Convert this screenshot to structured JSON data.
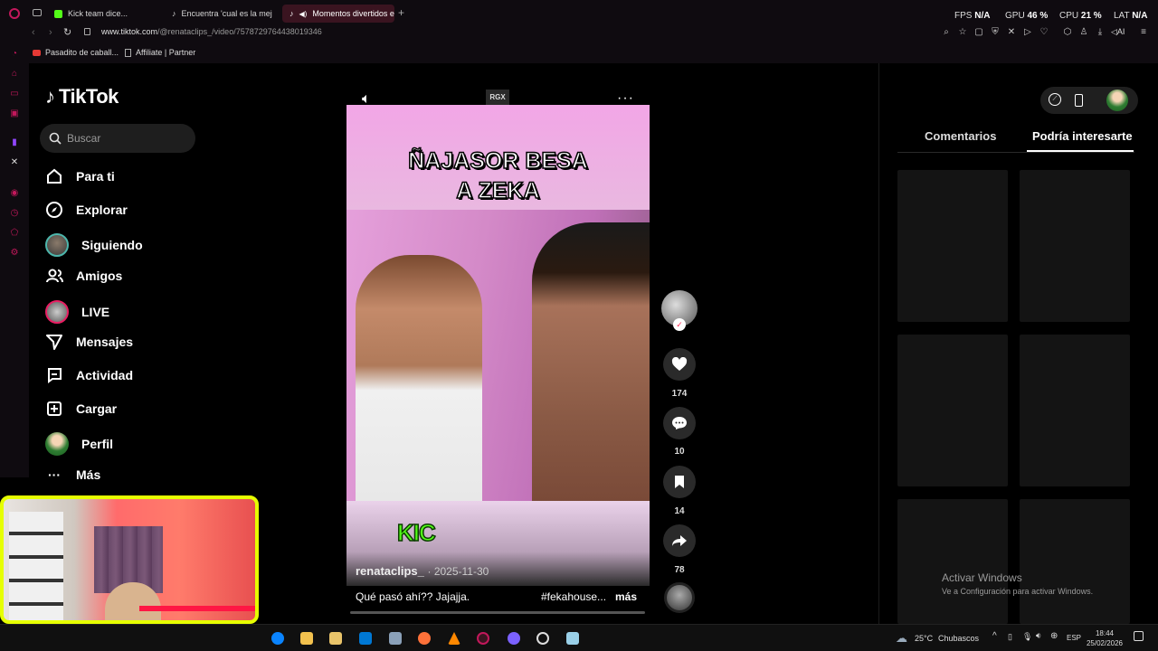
{
  "tabs": [
    {
      "label": "Kick team dice...",
      "color": "#53fc18"
    },
    {
      "label": "Encuentra 'cual es la mej",
      "color": "#ffffff"
    },
    {
      "label": "Momentos divertidos e",
      "color": "#ffffff"
    }
  ],
  "stats": {
    "fps_label": "FPS",
    "fps": "N/A",
    "gpu_label": "GPU",
    "gpu": "46 %",
    "cpu_label": "CPU",
    "cpu": "21 %",
    "lat_label": "LAT",
    "lat": "N/A"
  },
  "address": {
    "url_host": "www.tiktok.com",
    "url_path": "/@renataclips_/video/7578729764438019346"
  },
  "bookmarks": [
    "Pasadito de caball...",
    "Affiliate | Partner"
  ],
  "ai_label": "AI",
  "tiktok": {
    "logo": "TikTok",
    "search_placeholder": "Buscar",
    "nav": [
      {
        "label": "Para ti",
        "icon": "home-icon"
      },
      {
        "label": "Explorar",
        "icon": "compass-icon"
      },
      {
        "label": "Siguiendo",
        "icon": "avatar"
      },
      {
        "label": "Amigos",
        "icon": "friends-icon"
      },
      {
        "label": "LIVE",
        "icon": "live-avatar"
      },
      {
        "label": "Mensajes",
        "icon": "send-icon"
      },
      {
        "label": "Actividad",
        "icon": "activity-icon"
      },
      {
        "label": "Cargar",
        "icon": "upload-icon"
      },
      {
        "label": "Perfil",
        "icon": "profile-avatar"
      },
      {
        "label": "Más",
        "icon": "more-icon"
      }
    ]
  },
  "video": {
    "channel_badge": "RGX",
    "caption_title_1": "ÑAJASOR BESA",
    "caption_title_2": "A ZEKA",
    "kick_logo": "KIC",
    "author": "renataclips_",
    "date": "· 2025-11-30",
    "description": "Qué pasó ahí?? Jajajja.",
    "hashtag": "#fekahouse...",
    "more": "más"
  },
  "actions": {
    "likes": "174",
    "comments": "10",
    "saves": "14",
    "shares": "78"
  },
  "right_panel": {
    "tab_comments": "Comentarios",
    "tab_suggest": "Podría interesarte"
  },
  "watermark": {
    "line1": "Activar Windows",
    "line2": "Ve a Configuración para activar Windows."
  },
  "taskbar": {
    "weather": "25°C",
    "weather_text": "Chubascos",
    "lang": "ESP",
    "time": "18:44",
    "date": "25/02/2026"
  },
  "colors": {
    "accent": "#c2185b",
    "kick_green": "#53fc18",
    "pink_bg": "#e6a0d8"
  }
}
